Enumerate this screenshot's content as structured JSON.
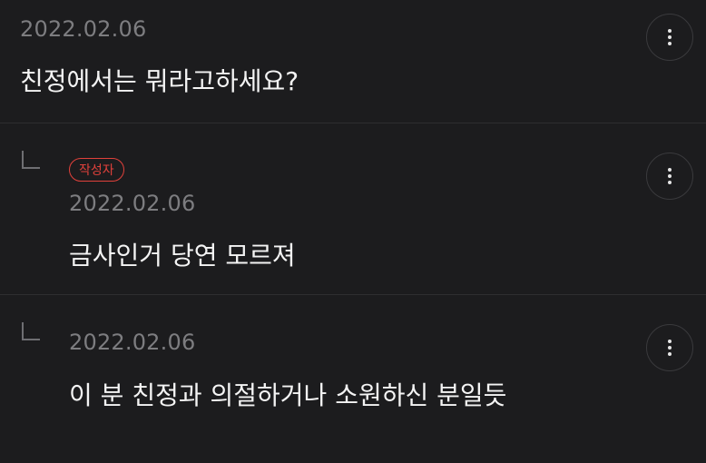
{
  "comments": [
    {
      "date": "2022.02.06",
      "text": "친정에서는 뭐라고하세요?",
      "more_icon": "more-vertical-icon"
    },
    {
      "badge": "작성자",
      "date": "2022.02.06",
      "text": "금사인거 당연 모르져",
      "reply_icon": "reply-arrow-icon",
      "more_icon": "more-vertical-icon"
    },
    {
      "date": "2022.02.06",
      "text": "이 분 친정과 의절하거나 소원하신 분일듯",
      "reply_icon": "reply-arrow-icon",
      "more_icon": "more-vertical-icon"
    }
  ],
  "colors": {
    "background": "#1c1c1e",
    "divider": "#2e2e30",
    "date": "#7d7d80",
    "text": "#f4f4f4",
    "author_badge": "#e0413b"
  }
}
